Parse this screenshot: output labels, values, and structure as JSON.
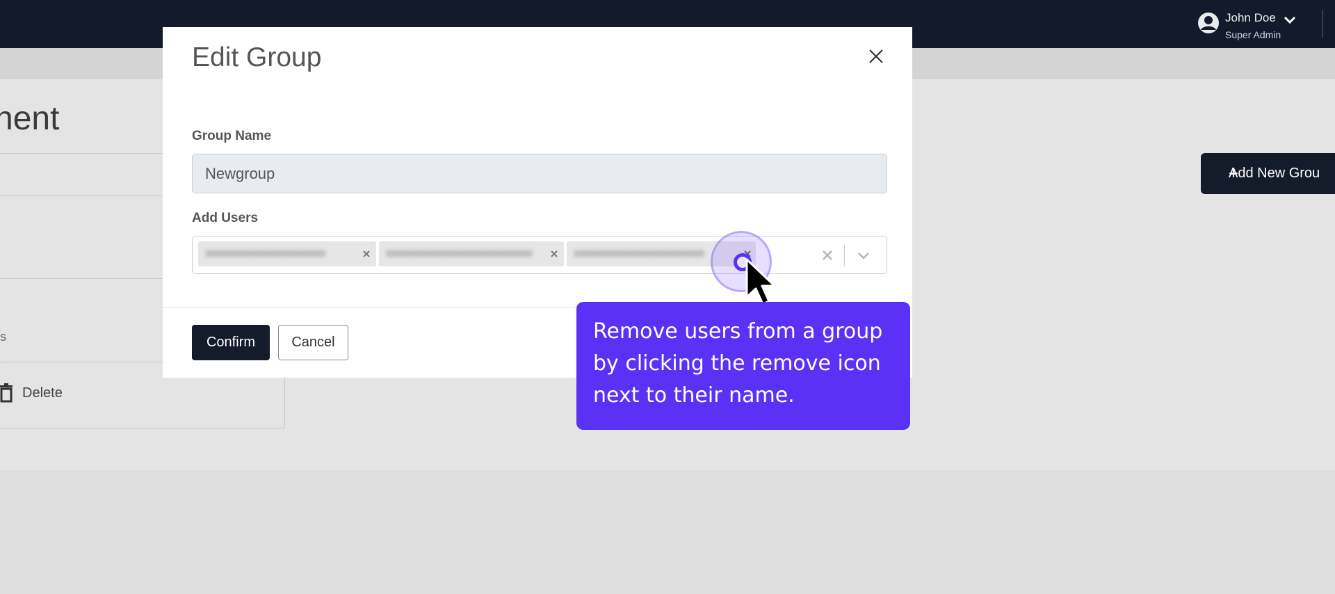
{
  "header": {
    "user_name": "John Doe",
    "user_role": "Super Admin",
    "avatar_icon": "user-circle-icon",
    "menu_icon": "chevron-down-icon"
  },
  "background_page": {
    "title_fragment": "nent",
    "side_text_fragment": "s",
    "delete_label": "Delete",
    "add_group_label": "Add New Grou"
  },
  "modal": {
    "title": "Edit Group",
    "group_name_label": "Group Name",
    "group_name_value": "Newgroup",
    "add_users_label": "Add Users",
    "selected_users": [
      "xxxxxxxxxxxxxxxxxxxxxxx",
      "xxxxxxxxxxxxxxxxxxxxxxxxxxxx",
      "xxxxxxxxxxxxxxxxxxxxxxxxx"
    ],
    "confirm_label": "Confirm",
    "cancel_label": "Cancel"
  },
  "tooltip": {
    "line1": "Remove users from a group",
    "line2": "by clicking the remove icon",
    "line3": "next to their name."
  },
  "colors": {
    "topbar": "#131a2b",
    "primary_button": "#141b2b",
    "tooltip": "#5b31f5"
  }
}
